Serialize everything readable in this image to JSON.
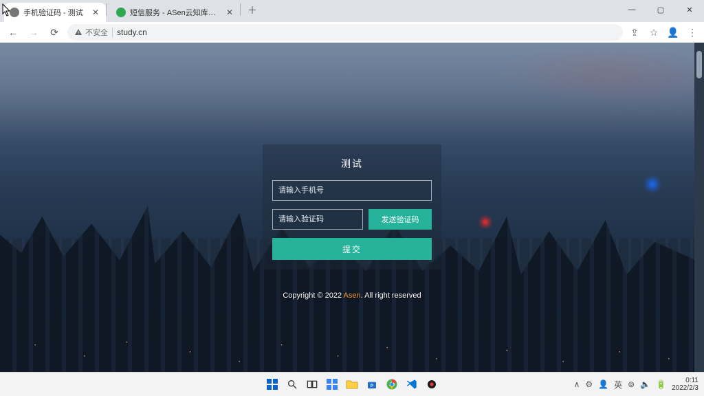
{
  "tabs": [
    {
      "label": "手机验证码 - 测试",
      "favicon_color": "#777777"
    },
    {
      "label": "短信服务 - ASen云知库开发API",
      "favicon_color": "#2fa84f"
    }
  ],
  "window_controls": {
    "minimize": "—",
    "maximize": "▢",
    "close": "✕"
  },
  "nav": {
    "back": "←",
    "forward": "→",
    "reload": "⟳"
  },
  "url": {
    "security_label": "不安全",
    "address": "study.cn"
  },
  "addr_icons": {
    "share": "⇪",
    "star": "☆",
    "profile": "👤",
    "menu": "⋮"
  },
  "form": {
    "title": "测试",
    "phone_placeholder": "请输入手机号",
    "code_placeholder": "请输入验证码",
    "send_label": "发送验证码",
    "submit_label": "提交"
  },
  "footer": {
    "prefix": "Copyright © 2022 ",
    "link": "Asen",
    "suffix": ". All right reserved"
  },
  "taskbar": {
    "apps": [
      "start",
      "search",
      "taskview",
      "widgets",
      "explorer",
      "store",
      "chrome",
      "vscode",
      "record"
    ]
  },
  "tray": {
    "icons": [
      "∧",
      "⚙",
      "👤",
      "英",
      "⊚",
      "🔈",
      "🔋"
    ],
    "time": "0:11",
    "date": "2022/2/3"
  }
}
